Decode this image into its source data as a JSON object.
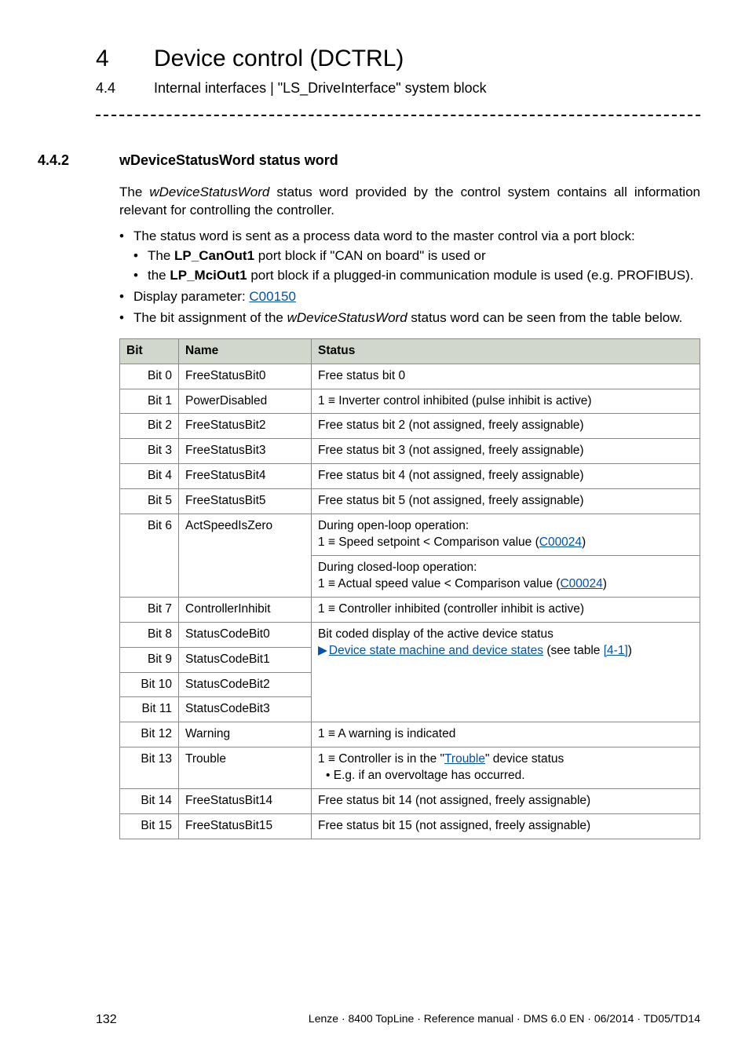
{
  "header": {
    "chapter_num": "4",
    "chapter_title": "Device control (DCTRL)",
    "sub_num": "4.4",
    "sub_title": "Internal interfaces | \"LS_DriveInterface\" system block"
  },
  "section": {
    "num": "4.4.2",
    "title": "wDeviceStatusWord status word"
  },
  "intro": {
    "p1a": "The ",
    "p1i": "wDeviceStatusWord",
    "p1b": " status word provided by the control system contains all information relevant for controlling the controller."
  },
  "bullets": {
    "b1": "The status word is sent as a process data word to the master control via a port block:",
    "b1a_pre": "The ",
    "b1a_bold": "LP_CanOut1",
    "b1a_post": " port block if \"CAN on board\" is used or",
    "b1b_pre": "the ",
    "b1b_bold": "LP_MciOut1",
    "b1b_post": " port block if a plugged-in communication module is used (e.g. PROFIBUS).",
    "b2_pre": "Display parameter: ",
    "b2_link": "C00150",
    "b3_pre": "The bit assignment of the ",
    "b3_i": "wDeviceStatusWord",
    "b3_post": " status word can be seen from the table below."
  },
  "table": {
    "headers": {
      "bit": "Bit",
      "name": "Name",
      "status": "Status"
    },
    "device_state_link_pre": "Device state machine and device states",
    "device_state_link_post": " (see table ",
    "device_state_link_ref": "[4-1]",
    "device_state_link_close": ")",
    "bitcoded_intro": "Bit coded display of the active device status",
    "rows": [
      {
        "bit": "Bit 0",
        "name": "FreeStatusBit0",
        "status": "Free status bit 0"
      },
      {
        "bit": "Bit 1",
        "name": "PowerDisabled",
        "status": "1 ≡ Inverter control inhibited (pulse inhibit is active)"
      },
      {
        "bit": "Bit 2",
        "name": "FreeStatusBit2",
        "status": "Free status bit 2 (not assigned, freely assignable)"
      },
      {
        "bit": "Bit 3",
        "name": "FreeStatusBit3",
        "status": "Free status bit 3 (not assigned, freely assignable)"
      },
      {
        "bit": "Bit 4",
        "name": "FreeStatusBit4",
        "status": "Free status bit 4 (not assigned, freely assignable)"
      },
      {
        "bit": "Bit 5",
        "name": "FreeStatusBit5",
        "status": "Free status bit 5 (not assigned, freely assignable)"
      },
      {
        "bit": "Bit 6",
        "name": "ActSpeedIsZero",
        "status_open_a": "During open-loop operation:",
        "status_open_b_pre": "1 ≡ Speed setpoint < Comparison value (",
        "status_open_b_link": "C00024",
        "status_open_b_post": ")",
        "status_closed_a": "During closed-loop operation:",
        "status_closed_b_pre": "1 ≡ Actual speed value < Comparison value (",
        "status_closed_b_link": "C00024",
        "status_closed_b_post": ")"
      },
      {
        "bit": "Bit 7",
        "name": "ControllerInhibit",
        "status": "1 ≡ Controller inhibited (controller inhibit is active)"
      },
      {
        "bit": "Bit 8",
        "name": "StatusCodeBit0"
      },
      {
        "bit": "Bit 9",
        "name": "StatusCodeBit1"
      },
      {
        "bit": "Bit 10",
        "name": "StatusCodeBit2"
      },
      {
        "bit": "Bit 11",
        "name": "StatusCodeBit3"
      },
      {
        "bit": "Bit 12",
        "name": "Warning",
        "status": "1 ≡ A warning is indicated"
      },
      {
        "bit": "Bit 13",
        "name": "Trouble",
        "status_a_pre": "1 ≡ Controller is in the \"",
        "status_a_link": "Trouble",
        "status_a_post": "\" device status",
        "status_b": "• E.g. if an overvoltage has occurred."
      },
      {
        "bit": "Bit 14",
        "name": "FreeStatusBit14",
        "status": "Free status bit 14 (not assigned, freely assignable)"
      },
      {
        "bit": "Bit 15",
        "name": "FreeStatusBit15",
        "status": "Free status bit 15 (not assigned, freely assignable)"
      }
    ]
  },
  "footer": {
    "page": "132",
    "right": "Lenze · 8400 TopLine · Reference manual · DMS 6.0 EN · 06/2014 · TD05/TD14"
  }
}
